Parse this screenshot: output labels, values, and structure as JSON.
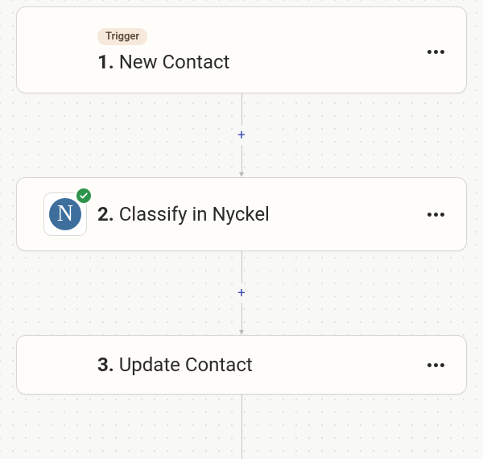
{
  "steps": [
    {
      "badge": "Trigger",
      "number": "1.",
      "label": "New Contact",
      "hasBadge": true,
      "hasAppIcon": false,
      "hasCheck": false
    },
    {
      "number": "2.",
      "label": "Classify in Nyckel",
      "hasBadge": false,
      "hasAppIcon": true,
      "appInitial": "N",
      "hasCheck": true
    },
    {
      "number": "3.",
      "label": "Update Contact",
      "hasBadge": false,
      "hasAppIcon": false,
      "hasCheck": false
    }
  ],
  "icons": {
    "plus": "+",
    "arrow": "▾"
  }
}
